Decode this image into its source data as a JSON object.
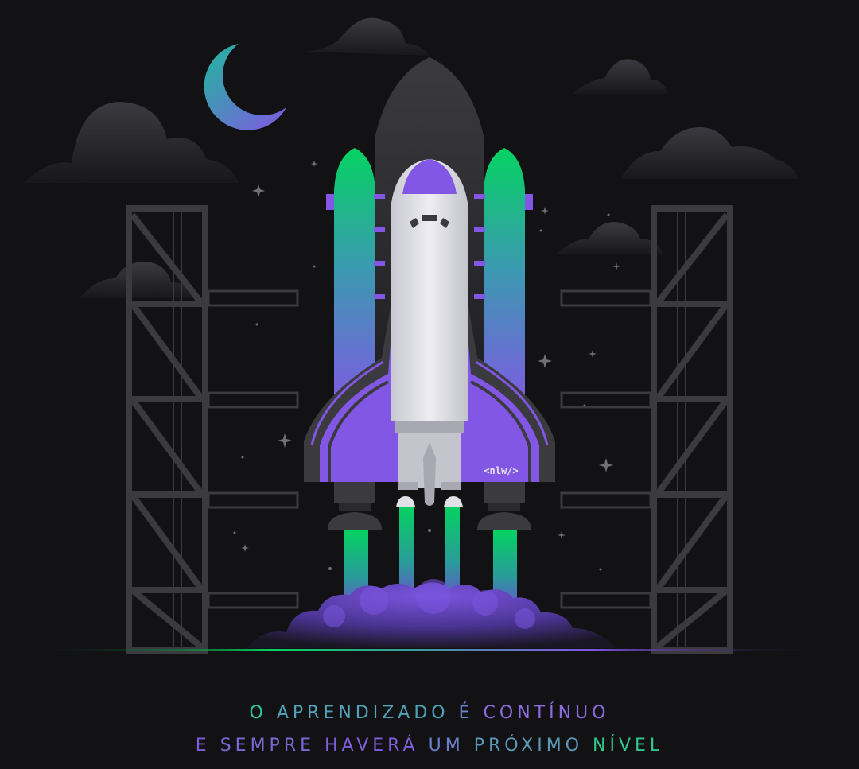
{
  "illustration": {
    "badge_text": "<nlw/>",
    "colors": {
      "background": "#121214",
      "structure": "#3a3a3f",
      "shuttle_body": "#e1e1e6",
      "purple": "#8257e5",
      "green": "#04d361",
      "teal": "#1db5a0",
      "smoke": "#5b3fb0"
    }
  },
  "caption": {
    "line1": [
      {
        "text": "O",
        "color": "#2fc59a"
      },
      {
        "text": "APRENDIZADO",
        "color": "#4ea3b8"
      },
      {
        "text": "É",
        "color": "#6a86cc"
      },
      {
        "text": "CONTÍNUO",
        "color": "#8d6be0"
      }
    ],
    "line2": [
      {
        "text": "E",
        "color": "#7a5fd6"
      },
      {
        "text": "SEMPRE",
        "color": "#7a68d4"
      },
      {
        "text": "HAVERÁ",
        "color": "#7f5fe0"
      },
      {
        "text": "UM",
        "color": "#6b7fc8"
      },
      {
        "text": "PRÓXIMO",
        "color": "#5a98b6"
      },
      {
        "text": "NÍVEL",
        "color": "#30c98c"
      }
    ]
  }
}
